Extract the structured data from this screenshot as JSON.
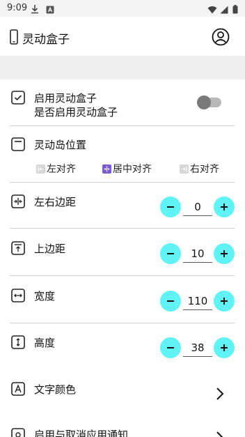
{
  "status_bar": {
    "time": "9:09"
  },
  "app_bar": {
    "title": "灵动盒子"
  },
  "enable_section": {
    "title": "启用灵动盒子",
    "subtitle": "是否启用灵动盒子",
    "toggle_on": false
  },
  "position_section": {
    "title": "灵动岛位置",
    "options": [
      {
        "label": "左对齐",
        "selected": false
      },
      {
        "label": "居中对齐",
        "selected": true
      },
      {
        "label": "右对齐",
        "selected": false
      }
    ]
  },
  "margin_lr": {
    "title": "左右边距",
    "value": "0"
  },
  "margin_top": {
    "title": "上边距",
    "value": "10"
  },
  "width": {
    "title": "宽度",
    "value": "110"
  },
  "height": {
    "title": "高度",
    "value": "38"
  },
  "text_color": {
    "title": "文字颜色"
  },
  "notifications": {
    "title": "启用与取消应用通知"
  },
  "colors": {
    "accent_cyan": "#5ff3f5",
    "accent_purple": "#7b5bd6",
    "divider": "#cfcfcf"
  }
}
